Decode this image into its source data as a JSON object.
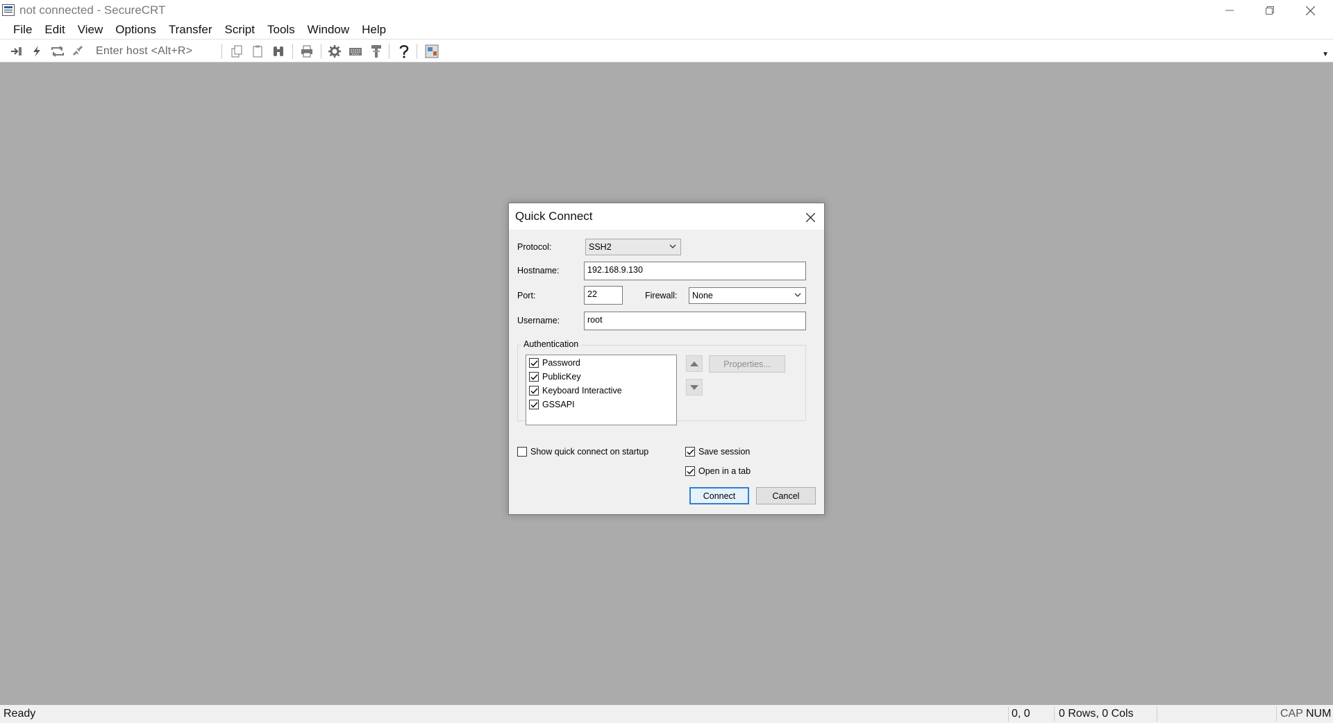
{
  "window": {
    "title": "not connected - SecureCRT"
  },
  "menu": [
    "File",
    "Edit",
    "View",
    "Options",
    "Transfer",
    "Script",
    "Tools",
    "Window",
    "Help"
  ],
  "toolbar": {
    "host_placeholder": "Enter host <Alt+R>",
    "icons": [
      "connect-icon",
      "quick-connect-icon",
      "reconnect-icon",
      "disconnect-icon",
      "copy-icon",
      "paste-icon",
      "find-icon",
      "print-icon",
      "session-options-icon",
      "keymap-icon",
      "sftp-icon",
      "help-icon",
      "screen-icon"
    ]
  },
  "dialog": {
    "title": "Quick Connect",
    "protocol_label": "Protocol:",
    "protocol_value": "SSH2",
    "hostname_label": "Hostname:",
    "hostname_value": "192.168.9.130",
    "port_label": "Port:",
    "port_value": "22",
    "firewall_label": "Firewall:",
    "firewall_value": "None",
    "username_label": "Username:",
    "username_value": "root",
    "auth_group_label": "Authentication",
    "auth_methods": [
      {
        "label": "Password",
        "checked": true
      },
      {
        "label": "PublicKey",
        "checked": true
      },
      {
        "label": "Keyboard Interactive",
        "checked": true
      },
      {
        "label": "GSSAPI",
        "checked": true
      }
    ],
    "properties_label": "Properties...",
    "show_on_startup_label": "Show quick connect on startup",
    "show_on_startup_checked": false,
    "save_session_label": "Save session",
    "save_session_checked": true,
    "open_in_tab_label": "Open in a tab",
    "open_in_tab_checked": true,
    "connect_label": "Connect",
    "cancel_label": "Cancel"
  },
  "status": {
    "text": "Ready",
    "cursor": "0, 0",
    "size": "0 Rows, 0 Cols",
    "cap": "CAP",
    "num": "NUM"
  },
  "colors": {
    "workspace": "#ababab",
    "accent": "#2f7fd0"
  }
}
